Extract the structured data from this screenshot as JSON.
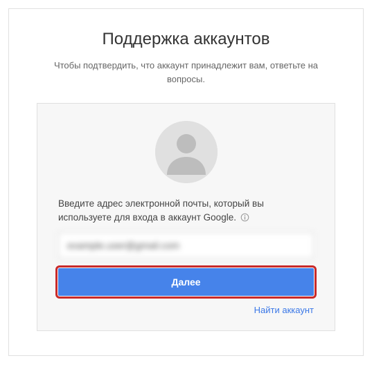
{
  "header": {
    "title": "Поддержка аккаунтов",
    "subtitle": "Чтобы подтвердить, что аккаунт принадлежит вам, ответьте на вопросы."
  },
  "form": {
    "instruction": "Введите адрес электронной почты, который вы используете для входа в аккаунт Google.",
    "email_value": "example.user@gmail.com",
    "next_label": "Далее",
    "find_account_label": "Найти аккаунт"
  }
}
